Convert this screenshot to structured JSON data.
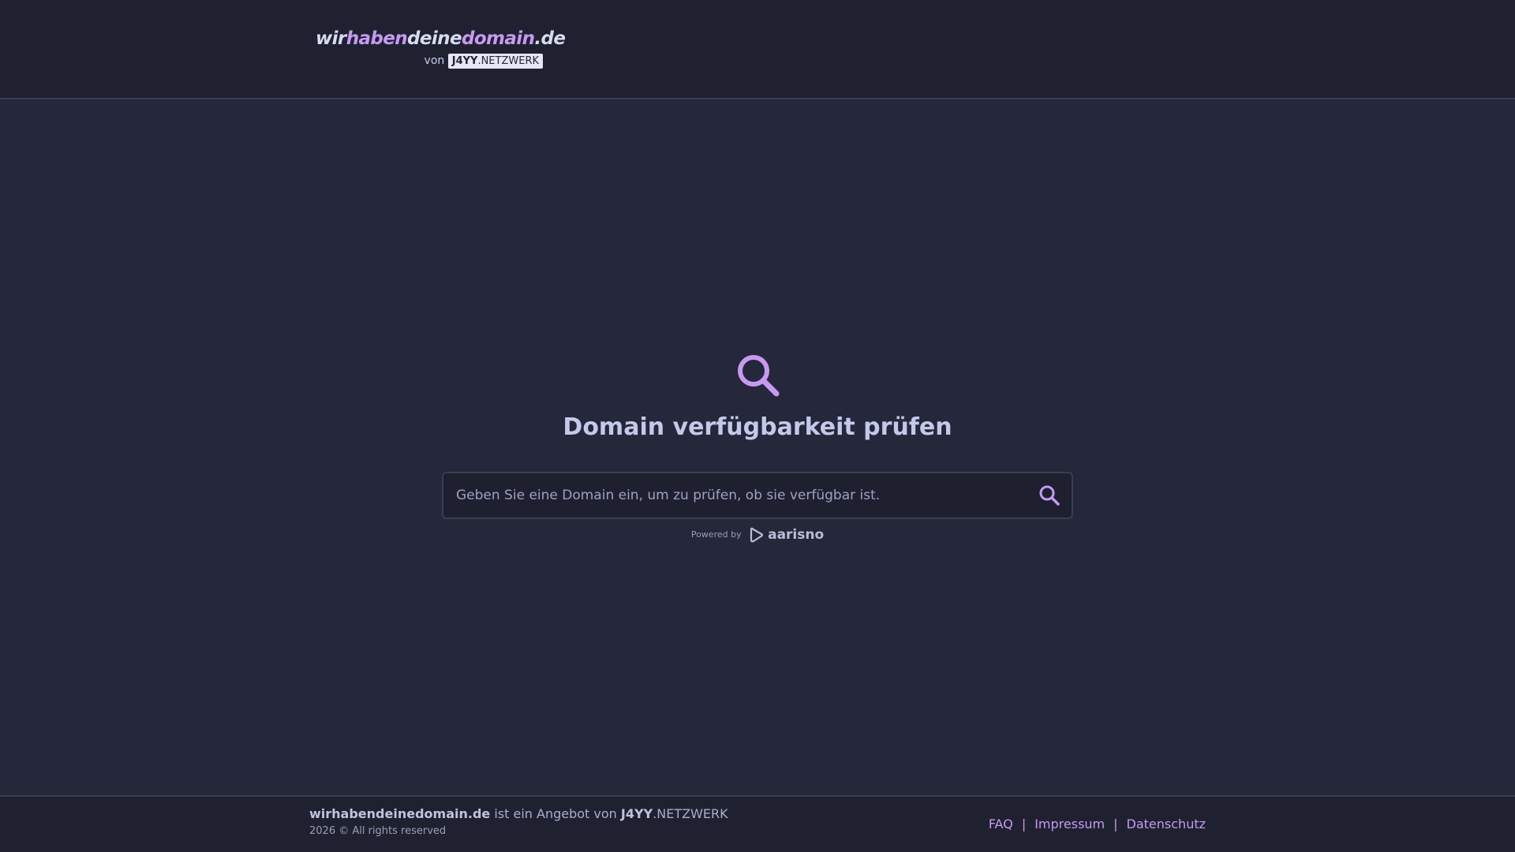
{
  "header": {
    "logo": {
      "part_wir": "wir",
      "part_haben": "haben",
      "part_deine": "deine",
      "part_domain": "domain",
      "part_tld": ".de",
      "von_label": "von",
      "badge_bold": "J4YY",
      "badge_rest": ".NETZWERK"
    }
  },
  "main": {
    "icon": "search-icon",
    "title": "Domain verfügbarkeit prüfen",
    "search": {
      "placeholder": "Geben Sie eine Domain ein, um zu prüfen, ob sie verfügbar ist.",
      "value": "",
      "button_icon": "search-icon"
    },
    "powered_by": {
      "label": "Powered by",
      "brand": "aarisno",
      "brand_icon": "aarisno-logo-icon"
    }
  },
  "footer": {
    "site_name": "wirhabendeinedomain.de",
    "offer_text": "ist ein Angebot von",
    "network_bold": "J4YY",
    "network_rest": ".NETZWERK",
    "copyright": "2026 © All rights reserved",
    "links": {
      "faq": "FAQ",
      "impressum": "Impressum",
      "datenschutz": "Datenschutz",
      "separator": "|"
    }
  },
  "colors": {
    "background": "#25273a",
    "header_bg": "#1f2131",
    "accent": "#c79af0",
    "title": "#c4c9ea"
  }
}
